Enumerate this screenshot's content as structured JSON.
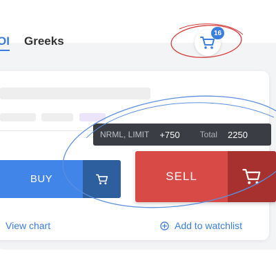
{
  "tabs": {
    "oi_label": "OI",
    "greeks_label": "Greeks"
  },
  "cart": {
    "badge_count": "16",
    "icon": "cart-icon"
  },
  "tooltip": {
    "mode": "NRML, LIMIT",
    "quantity": "+750",
    "total_label": "Total",
    "total_value": "2250"
  },
  "buttons": {
    "buy_label": "BUY",
    "sell_label": "SELL"
  },
  "links": {
    "view_chart": "View chart",
    "add_watchlist": "Add to watchlist"
  },
  "colors": {
    "accent": "#3b7ddd",
    "buy": "#4285e8",
    "sell": "#d84a45",
    "annotation_red": "#d63b3b",
    "annotation_blue": "#5b8fe0"
  }
}
